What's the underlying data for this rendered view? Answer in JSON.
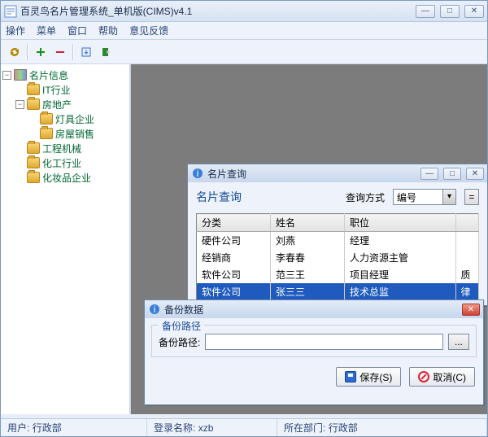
{
  "main": {
    "title": "百灵鸟名片管理系统_单机版(CIMS)v4.1",
    "menu": {
      "ops": "操作",
      "menu": "菜单",
      "win": "窗口",
      "help": "帮助",
      "feedback": "意见反馈"
    }
  },
  "tree": {
    "root": "名片信息",
    "items": [
      "IT行业",
      "房地产",
      "工程机械",
      "化工行业",
      "化妆品企业"
    ],
    "sub": [
      "灯具企业",
      "房屋销售"
    ]
  },
  "query": {
    "title": "名片查询",
    "heading": "名片查询",
    "method_label": "查询方式",
    "method_value": "编号",
    "cols": [
      "分类",
      "姓名",
      "职位"
    ],
    "rows": [
      [
        "硬件公司",
        "刘燕",
        "经理",
        ""
      ],
      [
        "经销商",
        "李春春",
        "人力资源主管",
        ""
      ],
      [
        "软件公司",
        "范三王",
        "项目经理",
        "质"
      ],
      [
        "软件公司",
        "张三三",
        "技术总监",
        "律"
      ]
    ]
  },
  "backup": {
    "title": "备份数据",
    "group": "备份路径",
    "label": "备份路径:",
    "path": "",
    "browse": "...",
    "save": "保存(S)",
    "cancel": "取消(C)"
  },
  "status": {
    "user_l": "用户:",
    "user": "行政部",
    "login_l": "登录名称:",
    "login": "xzb",
    "dept_l": "所在部门:",
    "dept": "行政部"
  }
}
